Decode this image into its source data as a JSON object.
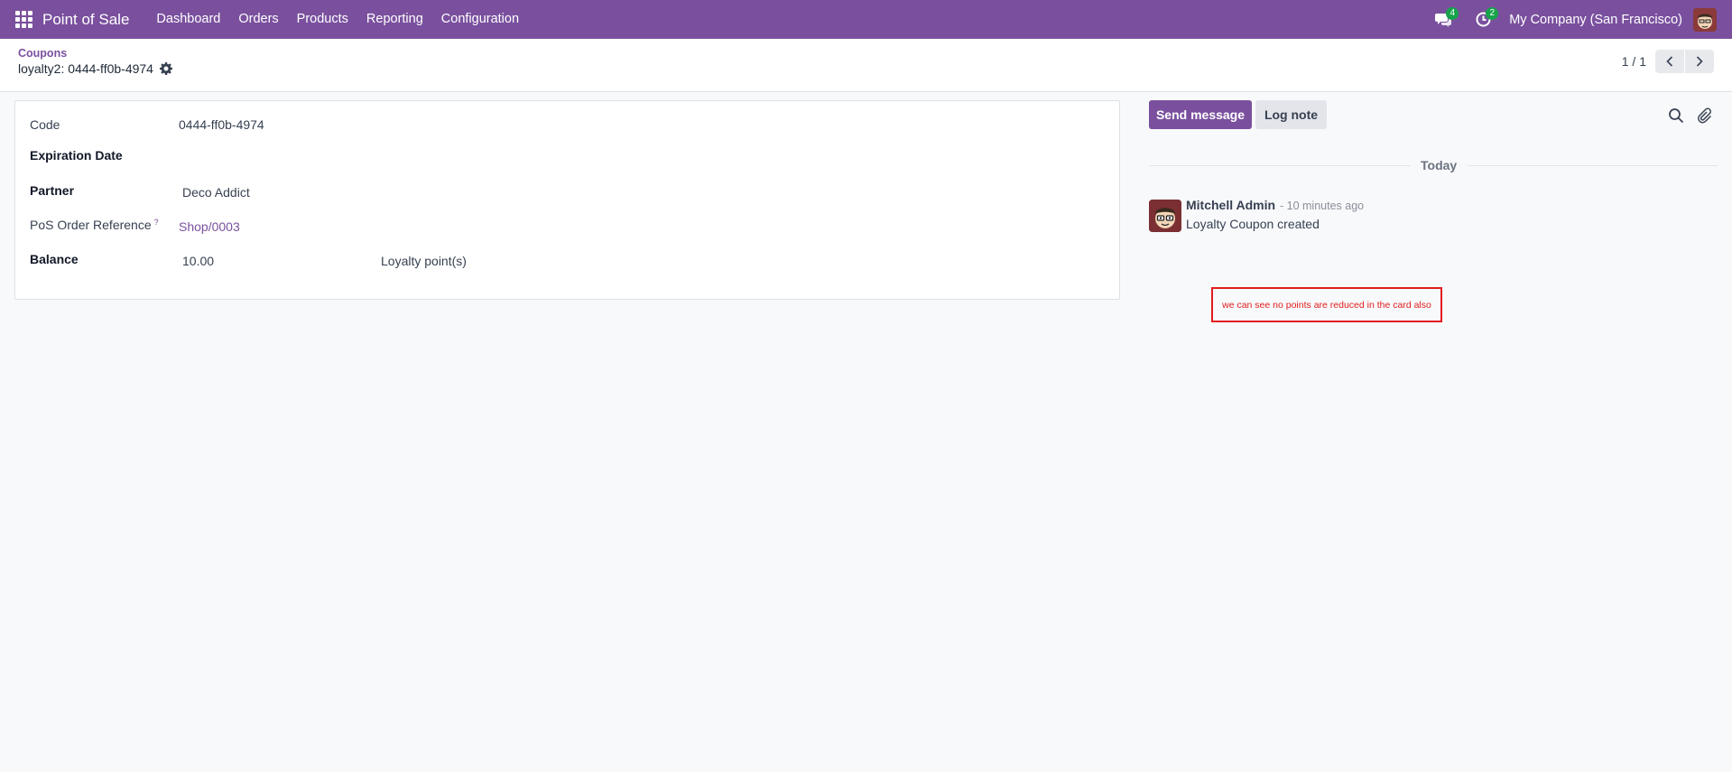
{
  "navbar": {
    "brand": "Point of Sale",
    "menu": [
      {
        "label": "Dashboard"
      },
      {
        "label": "Orders"
      },
      {
        "label": "Products"
      },
      {
        "label": "Reporting"
      },
      {
        "label": "Configuration"
      }
    ],
    "messages_badge": "4",
    "activities_badge": "2",
    "company": "My Company (San Francisco)",
    "accent_color": "#7a509e"
  },
  "breadcrumb": {
    "parent": "Coupons",
    "current": "loyalty2: 0444-ff0b-4974"
  },
  "pager": {
    "value": "1 / 1"
  },
  "form": {
    "code_label": "Code",
    "code_value": "0444-ff0b-4974",
    "expiration_label": "Expiration Date",
    "expiration_value": "",
    "partner_label": "Partner",
    "partner_value": "Deco Addict",
    "pos_ref_label": "PoS Order Reference",
    "pos_ref_help": "?",
    "pos_ref_value": "Shop/0003",
    "balance_label": "Balance",
    "balance_value": "10.00",
    "balance_unit": "Loyalty point(s)"
  },
  "chatter": {
    "send_message": "Send message",
    "log_note": "Log note",
    "date_separator": "Today",
    "messages": [
      {
        "author": "Mitchell Admin",
        "time": "- 10 minutes ago",
        "body": "Loyalty Coupon created"
      }
    ]
  },
  "annotation": {
    "text": "we can see no points are reduced in the card also",
    "color": "#e11d1d"
  }
}
